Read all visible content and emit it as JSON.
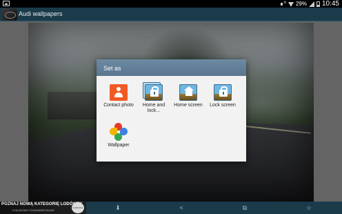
{
  "status_bar": {
    "battery_percent": "29%",
    "time": "10:45"
  },
  "app_bar": {
    "title": "Audi wallpapers"
  },
  "dialog": {
    "title": "Set as",
    "options": [
      {
        "label": "Contact photo",
        "icon": "contact-icon"
      },
      {
        "label": "Home and lock...",
        "icon": "home-lock-icon"
      },
      {
        "label": "Home screen",
        "icon": "home-screen-icon"
      },
      {
        "label": "Lock screen",
        "icon": "lock-screen-icon"
      },
      {
        "label": "Wallpaper",
        "icon": "wallpaper-icon"
      }
    ]
  },
  "ad_banner": {
    "headline": "POZNAJ NOWĄ KATEGORIĘ LODÓWEK",
    "subline": "CHŁODZIMY FUNDAMENTALNIE",
    "badge": "SAMSUNG"
  },
  "bottom_bar": {
    "icons": [
      "download-icon",
      "share-icon",
      "crop-icon",
      "favorite-icon"
    ]
  },
  "colors": {
    "app_bar": "#1b3a4a",
    "dialog_header": "#5a7690",
    "dialog_bg": "#f2f2f2"
  }
}
